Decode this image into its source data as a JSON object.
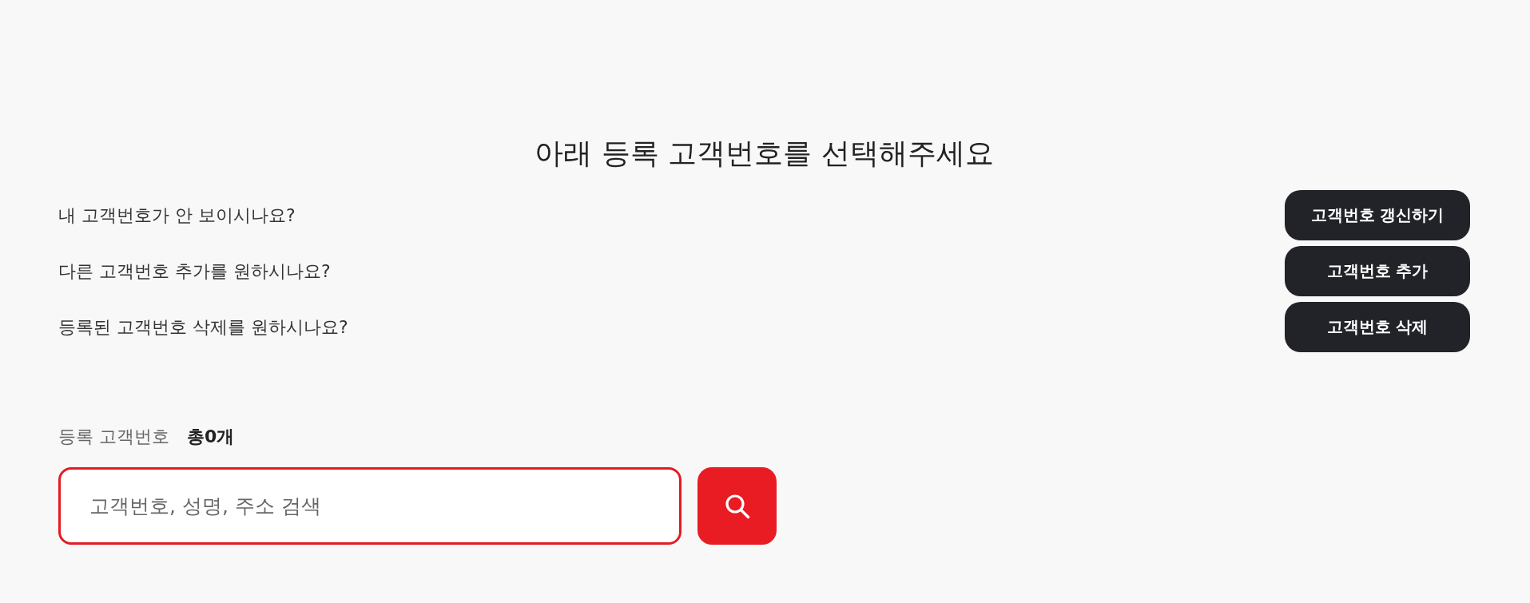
{
  "title": "아래 등록 고객번호를 선택해주세요",
  "actions": [
    {
      "question": "내 고객번호가 안 보이시나요?",
      "button": "고객번호 갱신하기"
    },
    {
      "question": "다른 고객번호 추가를 원하시나요?",
      "button": "고객번호 추가"
    },
    {
      "question": "등록된 고객번호 삭제를 원하시나요?",
      "button": "고객번호 삭제"
    }
  ],
  "registered": {
    "label": "등록 고객번호",
    "count": "총0개"
  },
  "search": {
    "placeholder": "고객번호, 성명, 주소 검색"
  }
}
